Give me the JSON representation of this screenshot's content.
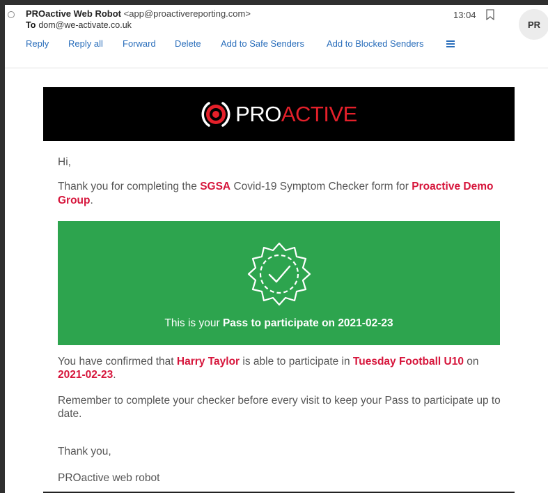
{
  "header": {
    "sender_name": "PROactive Web Robot",
    "sender_email": "<app@proactivereporting.com>",
    "to_label": "To",
    "to_address": "dom@we-activate.co.uk",
    "time": "13:04",
    "avatar_initials": "PR",
    "bookmark_icon": "bookmark-icon"
  },
  "actions": {
    "reply": "Reply",
    "reply_all": "Reply all",
    "forward": "Forward",
    "delete": "Delete",
    "safe_senders": "Add to Safe Senders",
    "blocked_senders": "Add to Blocked Senders",
    "more_icon": "hamburger-menu-icon"
  },
  "banner": {
    "logo_pro": "PRO",
    "logo_active": "ACTIVE",
    "logo_icon": "eye-target-icon"
  },
  "body": {
    "greeting": "Hi,",
    "p1_a": "Thank you for completing the ",
    "p1_org": "SGSA",
    "p1_b": " Covid-19 Symptom Checker form for ",
    "p1_group": "Proactive Demo Group",
    "p1_c": ".",
    "pass_prefix": "This is your ",
    "pass_bold": "Pass to participate on 2021-02-23",
    "p2_a": "You have confirmed that ",
    "p2_name": "Harry Taylor",
    "p2_b": " is able to participate in ",
    "p2_activity": "Tuesday Football U10",
    "p2_c": " on ",
    "p2_date": "2021-02-23",
    "p2_d": ".",
    "p3": "Remember to complete your checker before every visit to keep your Pass to participate up to date.",
    "thanks": "Thank you,",
    "signature": "PROactive web robot"
  },
  "colors": {
    "accent_red": "#d6153b",
    "pass_green": "#2da44e",
    "link_blue": "#2a6ebb"
  }
}
